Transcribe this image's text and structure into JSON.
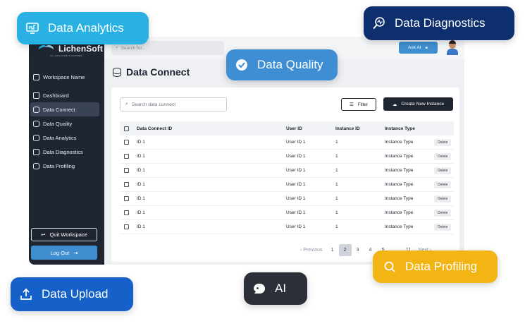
{
  "app": {
    "brand": "LichenSoft",
    "brand_sub": "ALL DATA ALWAYS ON-PREM",
    "search_placeholder": "Search for...",
    "ask_ai_label": "Ask AI"
  },
  "sidebar": {
    "items": [
      {
        "label": "Workspace Name",
        "icon": "workspace-icon"
      },
      {
        "label": "Dashboard",
        "icon": "home-icon"
      },
      {
        "label": "Data Connect",
        "icon": "database-icon",
        "active": true
      },
      {
        "label": "Data Quality",
        "icon": "database-check-icon"
      },
      {
        "label": "Data Analytics",
        "icon": "database-chart-icon"
      },
      {
        "label": "Data Diagnostics",
        "icon": "diagnostics-icon"
      },
      {
        "label": "Data Profiling",
        "icon": "database-search-icon"
      }
    ],
    "quit_label": "Quit Workspace",
    "logout_label": "Log Out"
  },
  "main": {
    "title": "Data Connect",
    "search_placeholder": "Search data connect",
    "filter_label": "Filter",
    "create_label": "Create New Instance",
    "table": {
      "columns": [
        "Data Connect ID",
        "User ID",
        "Instance ID",
        "Instance Type"
      ],
      "rows": [
        [
          "ID 1",
          "User ID 1",
          "1",
          "Instance Type",
          "Delete"
        ],
        [
          "ID 1",
          "User ID 1",
          "1",
          "Instance Type",
          "Delete"
        ],
        [
          "ID 1",
          "User ID 1",
          "1",
          "Instance Type",
          "Delete"
        ],
        [
          "ID 1",
          "User ID 1",
          "1",
          "Instance Type",
          "Delete"
        ],
        [
          "ID 1",
          "User ID 1",
          "1",
          "Instance Type",
          "Delete"
        ],
        [
          "ID 1",
          "User ID 1",
          "1",
          "Instance Type",
          "Delete"
        ],
        [
          "ID 1",
          "User ID 1",
          "1",
          "Instance Type",
          "Delete"
        ]
      ]
    },
    "pagination": {
      "prev_label": "Previous",
      "pages": [
        "1",
        "2",
        "3",
        "4",
        "5",
        "...",
        "11"
      ],
      "current": "2",
      "next_label": "Next"
    }
  },
  "pills": {
    "analytics": "Data Analytics",
    "diagnostics": "Data Diagnostics",
    "quality": "Data Quality",
    "profiling": "Data Profiling",
    "upload": "Data Upload",
    "ai": "AI"
  },
  "colors": {
    "sidebar_bg": "#1f2632",
    "accent_blue": "#3f8fd0",
    "analytics": "#29b1e3",
    "diagnostics": "#0d2f6e",
    "quality": "#3f8ed4",
    "profiling": "#f3b514",
    "upload": "#1560c9",
    "ai": "#2a2f38"
  }
}
